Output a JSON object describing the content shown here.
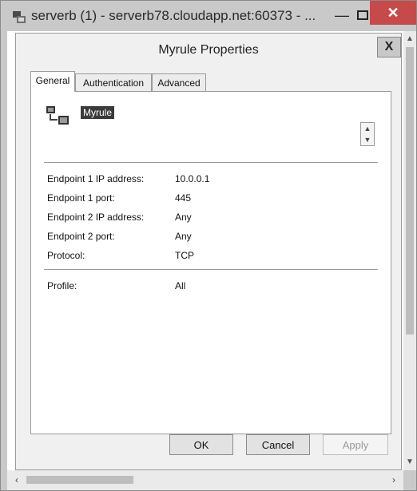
{
  "window": {
    "title": "serverb (1) - serverb78.cloudapp.net:60373 - ...",
    "minimize_icon": "minimize-icon",
    "maximize_icon": "maximize-icon",
    "close_glyph": "✕"
  },
  "dialog": {
    "title": "Myrule Properties",
    "close_glyph": "X",
    "tabs": [
      {
        "label": "General",
        "active": true
      },
      {
        "label": "Authentication",
        "active": false
      },
      {
        "label": "Advanced",
        "active": false
      }
    ],
    "rule_name": "Myrule",
    "fields": [
      {
        "label": "Endpoint 1 IP address:",
        "value": "10.0.0.1"
      },
      {
        "label": "Endpoint 1 port:",
        "value": "445"
      },
      {
        "label": "Endpoint 2 IP address:",
        "value": "Any"
      },
      {
        "label": "Endpoint 2 port:",
        "value": "Any"
      },
      {
        "label": "Protocol:",
        "value": "TCP"
      }
    ],
    "profile": {
      "label": "Profile:",
      "value": "All"
    },
    "buttons": {
      "ok": "OK",
      "cancel": "Cancel",
      "apply": "Apply"
    }
  },
  "colors": {
    "close_red": "#c74a4a",
    "selection_bg": "#3a3a3a"
  }
}
